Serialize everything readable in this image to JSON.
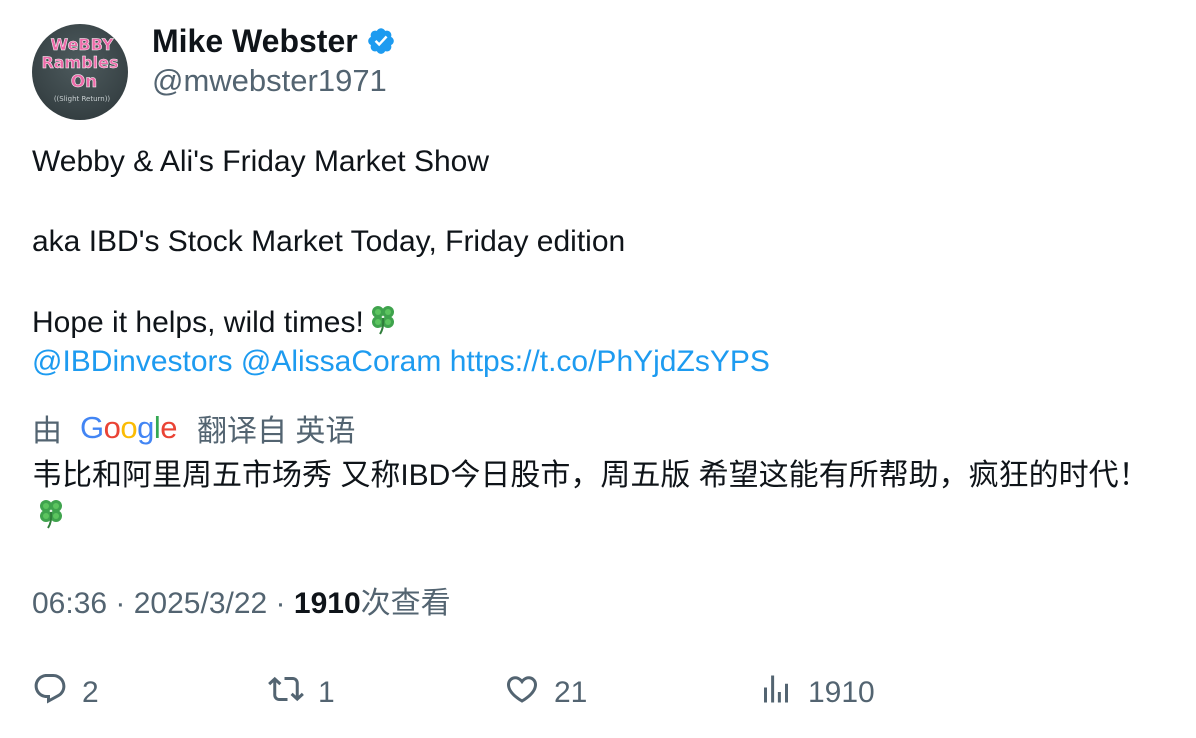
{
  "author": {
    "display_name": "Mike Webster",
    "handle": "@mwebster1971",
    "verified_icon": "verified-badge-icon",
    "avatar_text": [
      "WeBBY",
      "Rambles",
      "On",
      "((Slight Return))"
    ]
  },
  "tweet": {
    "lines": [
      "Webby & Ali's Friday Market Show",
      "aka IBD's Stock Market Today, Friday edition",
      "Hope it helps, wild times!"
    ],
    "mentions": [
      "@IBDinvestors",
      "@AlissaCoram"
    ],
    "link": "https://t.co/PhYjdZsYPS"
  },
  "translation": {
    "by_label": "由",
    "provider": "Google",
    "translated_from": "翻译自 英语",
    "text": "韦比和阿里周五市场秀 又称IBD今日股市，周五版 希望这能有所帮助，疯狂的时代！"
  },
  "meta": {
    "time": "06:36",
    "separator": " · ",
    "date": "2025/3/22",
    "views_count": "1910",
    "views_label": "次查看"
  },
  "actions": {
    "replies": "2",
    "retweets": "1",
    "likes": "21",
    "views": "1910"
  },
  "colors": {
    "link": "#1d9bf0",
    "secondary_text": "#536471",
    "primary_text": "#0f1419",
    "verified": "#1d9bf0"
  }
}
